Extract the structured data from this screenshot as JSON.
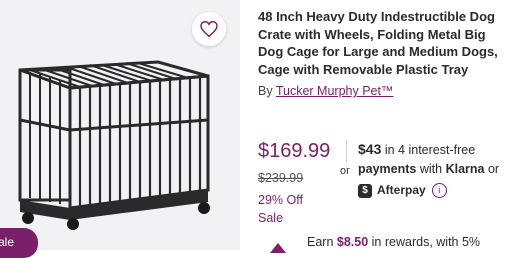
{
  "product": {
    "title": "48 Inch Heavy Duty Indestructible Dog Crate with Wheels, Folding Metal Big Dog Cage for Large and Medium Dogs, Cage with Removable Plastic Tray",
    "brand_prefix": "By",
    "brand_name": "Tucker Murphy Pet™",
    "image_icon": "dog-crate-image",
    "badge": "ale"
  },
  "pricing": {
    "price": "$169.99",
    "original_price": "$239.99",
    "discount": "29% Off",
    "sale_label": "Sale"
  },
  "installments": {
    "or_label": "or",
    "amount": "$43",
    "amount_suffix": "in 4 interest-free",
    "payments_label": "payments",
    "with_label": "with",
    "klarna": "Klarna",
    "or_after_klarna": "or",
    "afterpay": "Afterpay",
    "afterpay_logo": "$",
    "info_icon": "i"
  },
  "rewards": {
    "prefix": "Earn",
    "amount": "$8.50",
    "suffix": "in rewards, with 5%"
  },
  "colors": {
    "brand_purple": "#7b1f6b",
    "text": "#2b2b2b",
    "panel_bg": "#f2f2f4"
  }
}
